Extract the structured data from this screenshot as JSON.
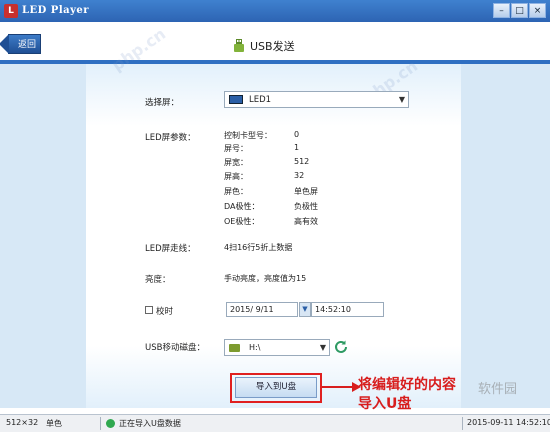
{
  "window": {
    "title": "LED Player",
    "app_icon_glyph": "L",
    "minimize": "–",
    "maximize": "□",
    "close": "×"
  },
  "header": {
    "back_label": "返回",
    "title": "USB发送"
  },
  "form": {
    "select_screen_label": "选择屏：",
    "selected_screen": "LED1",
    "screen_params_label": "LED屏参数：",
    "params": [
      {
        "key": "控制卡型号：",
        "value": "0"
      },
      {
        "key": "屏号：",
        "value": "1"
      },
      {
        "key": "屏宽：",
        "value": "512"
      },
      {
        "key": "屏高：",
        "value": "32"
      },
      {
        "key": "屏色：",
        "value": "单色屏"
      },
      {
        "key": "DA极性：",
        "value": "负极性"
      },
      {
        "key": "OE极性：",
        "value": "高有效"
      }
    ],
    "schedule_label": "LED屏走线：",
    "schedule_value": "4扫16行5折上数据",
    "brightness_label": "亮度：",
    "brightness_value": "手动亮度，亮度值为15",
    "time_sync_label": "校时",
    "date_value": "2015/ 9/11",
    "time_value": "14:52:10",
    "usb_disk_label": "USB移动磁盘：",
    "usb_disk_value": "H:\\",
    "export_button": "导入到U盘"
  },
  "annotation": {
    "line1": "将编辑好的内容",
    "line2": "导入U盘"
  },
  "watermarks": {
    "left": "php.cn",
    "right": "php.cn",
    "logo": "软件园"
  },
  "status": {
    "resolution": "512×32",
    "color_mode": "单色",
    "message": "正在导入U盘数据",
    "datetime": "2015-09-11  14:52:10"
  },
  "colors": {
    "accent": "#2f6fc2",
    "highlight": "#e02020"
  }
}
